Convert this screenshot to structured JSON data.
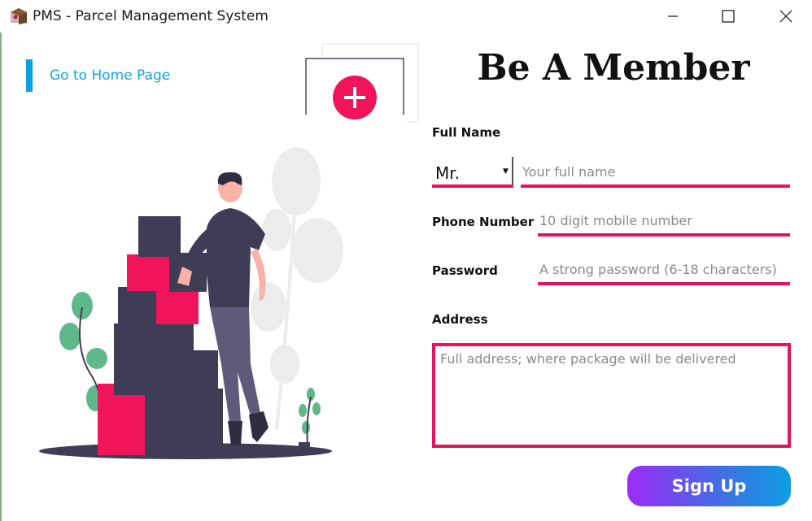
{
  "window": {
    "title": "PMS - Parcel Management System",
    "icon": "parcel-app-icon",
    "controls": [
      "minimize-icon",
      "maximize-icon",
      "close-icon"
    ]
  },
  "nav": {
    "home_link": "Go to Home Page"
  },
  "form": {
    "heading": "Be A Member",
    "full_name_label": "Full Name",
    "title_select_value": "Mr.",
    "full_name_placeholder": "Your full name",
    "phone_label": "Phone Number",
    "phone_placeholder": "10 digit mobile number",
    "password_label": "Password",
    "password_placeholder": "A strong password (6-18 characters)",
    "address_label": "Address",
    "address_placeholder": "Full address; where package will be delivered",
    "submit_label": "Sign Up"
  },
  "colors": {
    "accent": "#e8115a",
    "link": "#12a4ea",
    "button_gradient_start": "#9b2bf5",
    "button_gradient_end": "#0d9fe6"
  }
}
